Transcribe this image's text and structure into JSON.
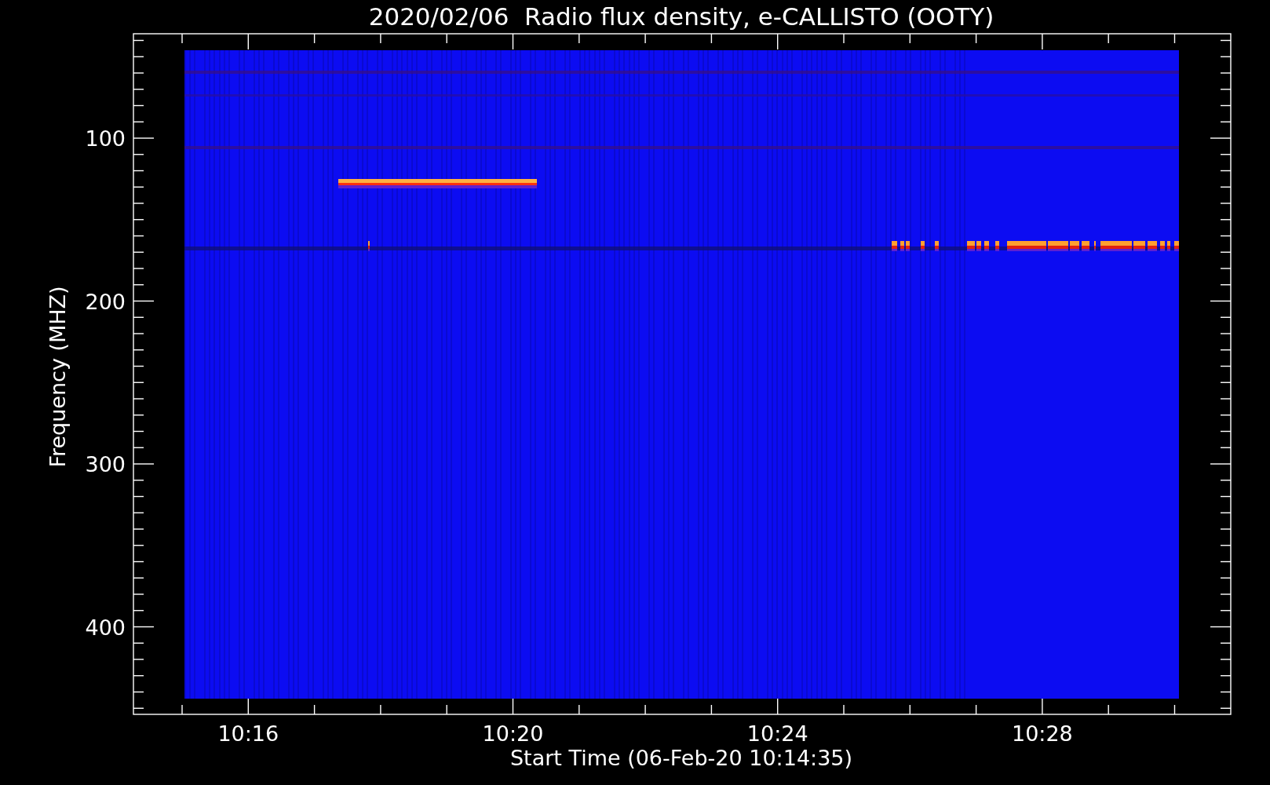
{
  "title": "2020/02/06  Radio flux density, e-CALLISTO (OOTY)",
  "y_axis": {
    "label": "Frequency (MHZ)",
    "ticks": [
      "100",
      "200",
      "300",
      "400"
    ]
  },
  "x_axis": {
    "label": "Start Time (06-Feb-20 10:14:35)",
    "ticks": [
      "10:16",
      "10:20",
      "10:24",
      "10:28"
    ]
  }
}
